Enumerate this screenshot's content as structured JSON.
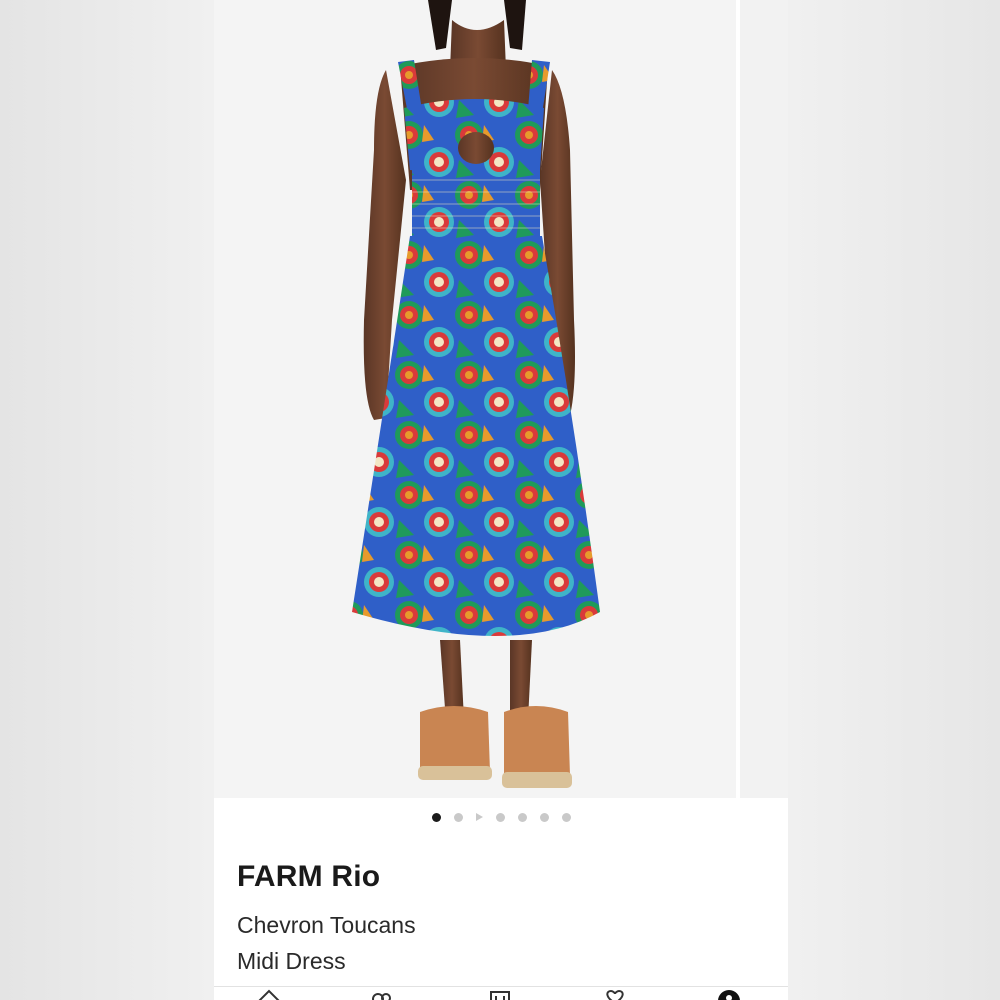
{
  "product": {
    "brand": "FARM Rio",
    "name_line1": "Chevron Toucans",
    "name_line2": "Midi Dress"
  },
  "gallery": {
    "dots": 6,
    "active_index": 0,
    "has_video": true
  },
  "tabbar": {
    "icons": [
      "home-icon",
      "people-icon",
      "calendar-icon",
      "heart-icon",
      "account-icon"
    ]
  },
  "colors": {
    "accent": "#1b1b1b",
    "dot_inactive": "#c9c9c9",
    "print_blue": "#2f5fc8",
    "print_green": "#1f9a5a",
    "print_red": "#d93a3a",
    "print_orange": "#e79a2c",
    "print_teal": "#3fb4c8"
  }
}
